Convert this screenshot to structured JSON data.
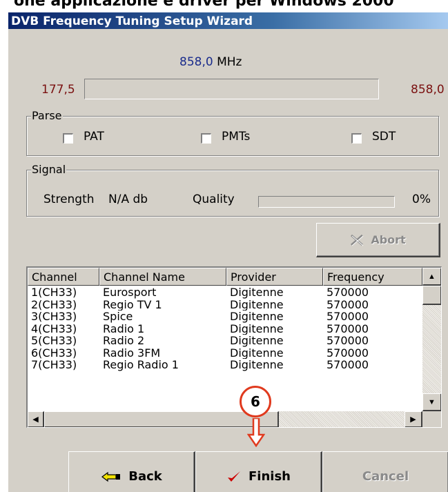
{
  "page_caption_fragment": "one applicazione e driver per Windows 2000",
  "window": {
    "title": "DVB Frequency Tuning Setup Wizard"
  },
  "frequency": {
    "current_value": "858,0",
    "unit": "MHz",
    "min": "177,5",
    "max": "858,0",
    "progress_percent": 0
  },
  "parse": {
    "group_title": "Parse",
    "items": [
      {
        "label": "PAT",
        "checked": false
      },
      {
        "label": "PMTs",
        "checked": false
      },
      {
        "label": "SDT",
        "checked": false
      }
    ]
  },
  "signal": {
    "group_title": "Signal",
    "strength_label": "Strength",
    "strength_value": "N/A db",
    "quality_label": "Quality",
    "quality_value": "0%",
    "quality_percent": 0
  },
  "abort": {
    "label": "Abort",
    "icon": "abort-x-icon",
    "enabled": false
  },
  "channels": {
    "columns": [
      "Channel",
      "Channel Name",
      "Provider",
      "Frequency"
    ],
    "rows": [
      [
        "1(CH33)",
        "Eurosport",
        "Digitenne",
        "570000"
      ],
      [
        "2(CH33)",
        "Regio TV 1",
        "Digitenne",
        "570000"
      ],
      [
        "3(CH33)",
        "Spice",
        "Digitenne",
        "570000"
      ],
      [
        "4(CH33)",
        "Radio 1",
        "Digitenne",
        "570000"
      ],
      [
        "5(CH33)",
        "Radio 2",
        "Digitenne",
        "570000"
      ],
      [
        "6(CH33)",
        "Radio 3FM",
        "Digitenne",
        "570000"
      ],
      [
        "7(CH33)",
        "Regio Radio 1",
        "Digitenne",
        "570000"
      ]
    ]
  },
  "annotation": {
    "number": "6",
    "color": "#e03a1e"
  },
  "footer": {
    "back_label": "Back",
    "back_icon": "back-hand-arrow-icon",
    "finish_label": "Finish",
    "finish_icon": "checkmark-icon",
    "finish_icon_color": "#cc0000",
    "cancel_label": "Cancel",
    "cancel_enabled": false
  }
}
